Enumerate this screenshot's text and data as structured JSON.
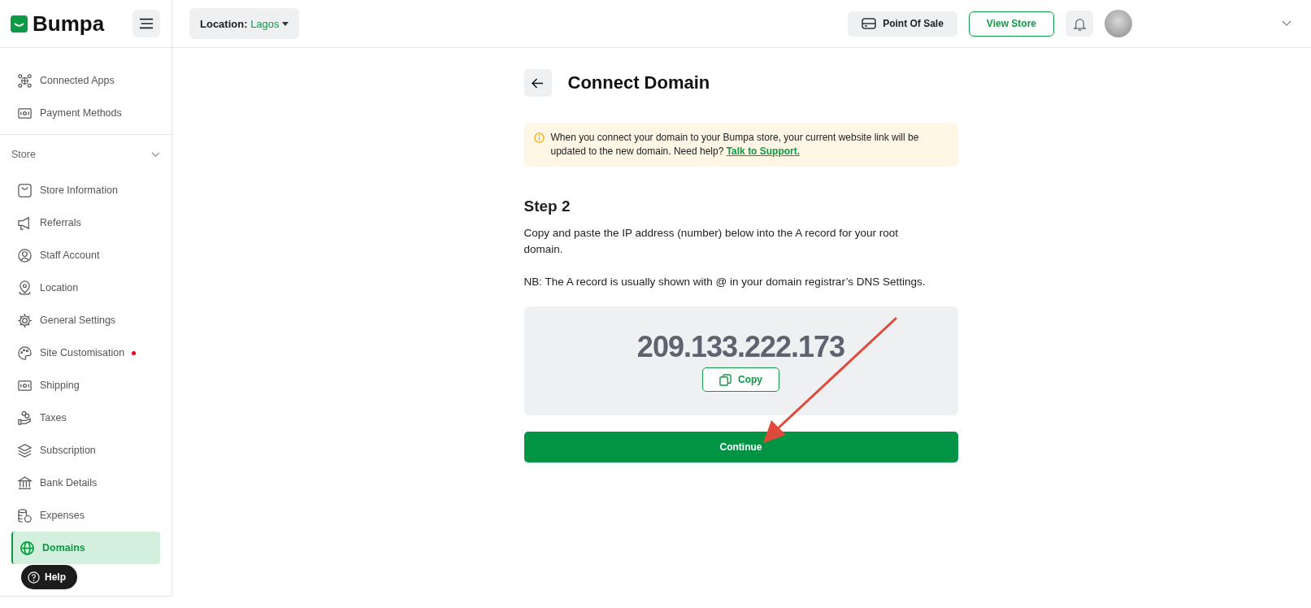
{
  "brand": {
    "name": "Bumpa"
  },
  "header": {
    "location_label": "Location:",
    "location_value": "Lagos",
    "pos_button": "Point Of Sale",
    "view_store_button": "View Store"
  },
  "sidebar": {
    "top_items": [
      {
        "label": "Connected Apps",
        "selected": false,
        "dot": false
      },
      {
        "label": "Payment Methods",
        "selected": false,
        "dot": false
      }
    ],
    "section": {
      "title": "Store",
      "expanded": true,
      "items": [
        {
          "label": "Store Information",
          "selected": false,
          "dot": false
        },
        {
          "label": "Referrals",
          "selected": false,
          "dot": false
        },
        {
          "label": "Staff Account",
          "selected": false,
          "dot": false
        },
        {
          "label": "Location",
          "selected": false,
          "dot": false
        },
        {
          "label": "General Settings",
          "selected": false,
          "dot": false
        },
        {
          "label": "Site Customisation",
          "selected": false,
          "dot": true
        },
        {
          "label": "Shipping",
          "selected": false,
          "dot": false
        },
        {
          "label": "Taxes",
          "selected": false,
          "dot": false
        },
        {
          "label": "Subscription",
          "selected": false,
          "dot": false
        },
        {
          "label": "Bank Details",
          "selected": false,
          "dot": false
        },
        {
          "label": "Expenses",
          "selected": false,
          "dot": false
        },
        {
          "label": "Domains",
          "selected": true,
          "dot": false
        }
      ]
    },
    "help_button": "Help"
  },
  "page": {
    "title": "Connect Domain",
    "notice": {
      "text": "When you connect your domain to your Bumpa store, your current website link will be updated to the new domain. Need help?",
      "link": "Talk to Support."
    },
    "step_title": "Step 2",
    "instructions": [
      "Copy and paste the IP address (number) below into the A record for your root domain.",
      "NB: The A record is usually shown with @ in your domain registrar’s DNS Settings."
    ],
    "ip_address": "209.133.222.173",
    "copy_button": "Copy",
    "continue_button": "Continue"
  }
}
